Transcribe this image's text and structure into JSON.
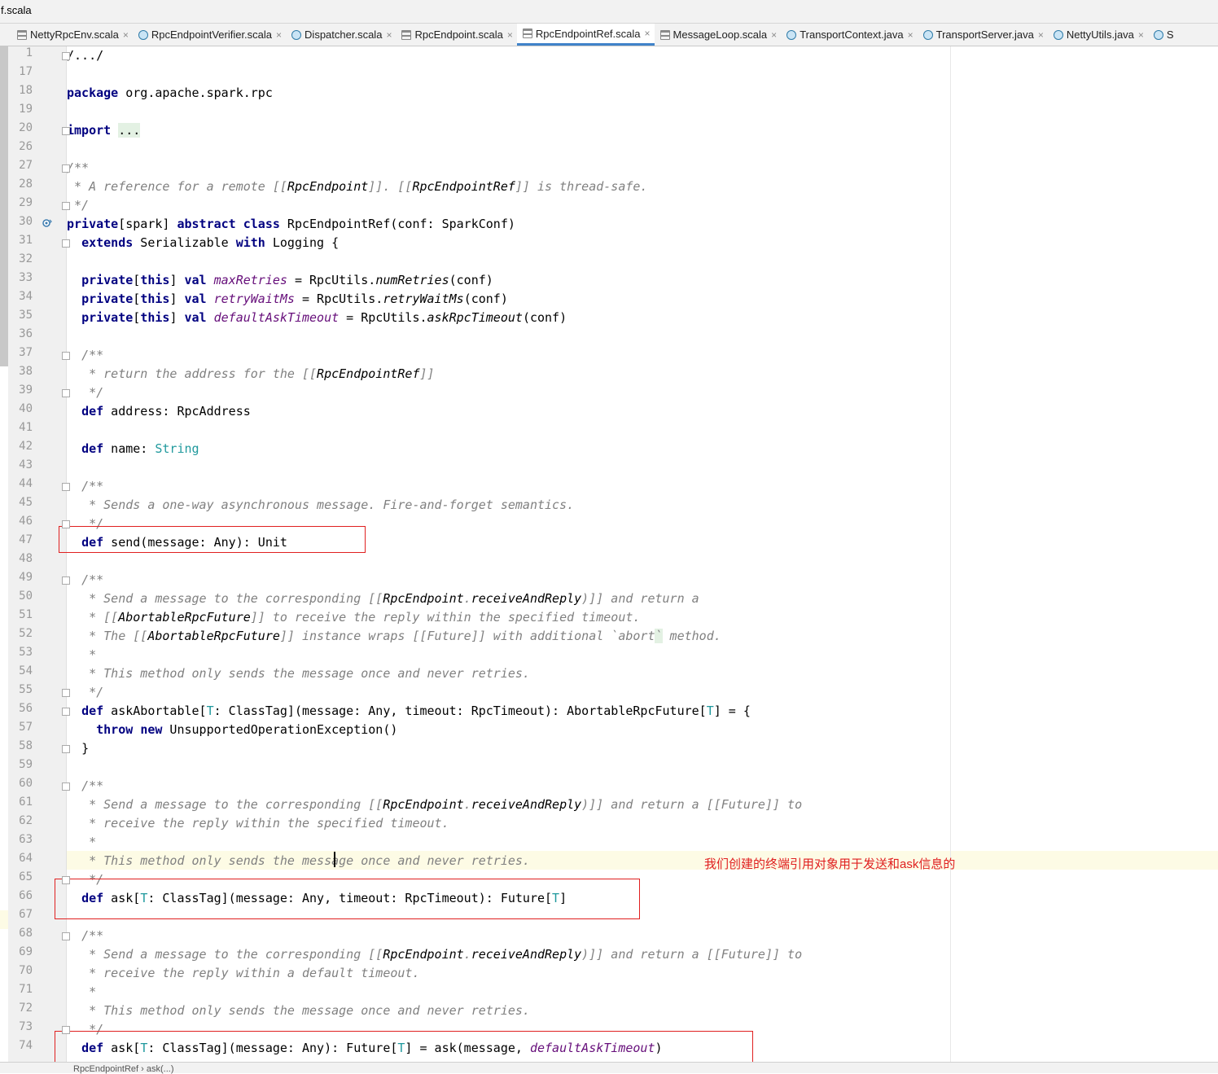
{
  "window": {
    "title": "f.scala"
  },
  "tabs": [
    {
      "label": "NettyRpcEnv.scala",
      "icon": "scala-file-icon",
      "active": false
    },
    {
      "label": "RpcEndpointVerifier.scala",
      "icon": "class-icon",
      "active": false
    },
    {
      "label": "Dispatcher.scala",
      "icon": "class-icon",
      "active": false
    },
    {
      "label": "RpcEndpoint.scala",
      "icon": "scala-file-icon",
      "active": false
    },
    {
      "label": "RpcEndpointRef.scala",
      "icon": "scala-file-icon",
      "active": true
    },
    {
      "label": "MessageLoop.scala",
      "icon": "scala-file-icon",
      "active": false
    },
    {
      "label": "TransportContext.java",
      "icon": "class-icon",
      "active": false
    },
    {
      "label": "TransportServer.java",
      "icon": "class-icon",
      "active": false
    },
    {
      "label": "NettyUtils.java",
      "icon": "class-icon",
      "active": false
    },
    {
      "label": "S",
      "icon": "class-icon",
      "active": false
    }
  ],
  "editor": {
    "line_numbers": [
      "1",
      "17",
      "18",
      "19",
      "20",
      "26",
      "27",
      "28",
      "29",
      "30",
      "31",
      "32",
      "33",
      "34",
      "35",
      "36",
      "37",
      "38",
      "39",
      "40",
      "41",
      "42",
      "43",
      "44",
      "45",
      "46",
      "47",
      "48",
      "49",
      "50",
      "51",
      "52",
      "53",
      "54",
      "55",
      "56",
      "57",
      "58",
      "59",
      "60",
      "61",
      "62",
      "63",
      "64",
      "65",
      "66",
      "67",
      "68",
      "69",
      "70",
      "71",
      "72",
      "73",
      "74"
    ],
    "code": {
      "l1": "/.../",
      "l18_kw": "package",
      "l18_rest": " org.apache.spark.rpc",
      "l20_kw": "import",
      "l20_dots": "...",
      "l27": "/**",
      "l28_a": " * A reference for a remote [[",
      "l28_b": "RpcEndpoint",
      "l28_c": "]]. [[",
      "l28_d": "RpcEndpointRef",
      "l28_e": "]] is thread-safe.",
      "l29": " */",
      "l30_kw1": "private",
      "l30_a": "[spark] ",
      "l30_kw2": "abstract class",
      "l30_b": " RpcEndpointRef(conf: SparkConf)",
      "l31_kw1": "extends",
      "l31_a": " Serializable ",
      "l31_kw2": "with",
      "l31_b": " Logging {",
      "l33_kw1": "private",
      "l33_a": "[",
      "l33_kw2": "this",
      "l33_b": "] ",
      "l33_kw3": "val",
      "l33_f": "maxRetries",
      "l33_c": " = RpcUtils.",
      "l33_m": "numRetries",
      "l33_d": "(conf)",
      "l34_f": "retryWaitMs",
      "l34_c": " = RpcUtils.",
      "l34_m": "retryWaitMs",
      "l34_d": "(conf)",
      "l35_f": "defaultAskTimeout",
      "l35_c": " = RpcUtils.",
      "l35_m": "askRpcTimeout",
      "l35_d": "(conf)",
      "l37": "/**",
      "l38_a": " * return the address for the [[",
      "l38_b": "RpcEndpointRef",
      "l38_c": "]]",
      "l39": " */",
      "l40_kw": "def",
      "l40_rest": " address: RpcAddress",
      "l42_kw": "def",
      "l42_a": " name: ",
      "l42_ty": "String",
      "l44": "/**",
      "l45": " * Sends a one-way asynchronous message. Fire-and-forget semantics.",
      "l46": " */",
      "l47_kw": "def",
      "l47_rest": " send(message: Any): Unit",
      "l49": "/**",
      "l50_a": " * Send a message to the corresponding [[",
      "l50_b": "RpcEndpoint",
      "l50_c": ".",
      "l50_d": "receiveAndReply",
      "l50_e": ")]] and return a",
      "l51_a": " * [[",
      "l51_b": "AbortableRpcFuture",
      "l51_c": "]] to receive the reply within the specified timeout.",
      "l52_a": " * The [[",
      "l52_b": "AbortableRpcFuture",
      "l52_c": "]] instance wraps [[Future]] with additional `abort",
      "l52_d": "`",
      "l52_e": " method.",
      "l53": " *",
      "l54": " * This method only sends the message once and never retries.",
      "l55": " */",
      "l56_kw": "def",
      "l56_a": " askAbortable[",
      "l56_t": "T",
      "l56_b": ": ClassTag](message: Any, timeout: RpcTimeout): AbortableRpcFuture[",
      "l56_t2": "T",
      "l56_c": "] = {",
      "l57_kw1": "throw",
      "l57_kw2": "new",
      "l57_rest": " UnsupportedOperationException()",
      "l58": "}",
      "l60": "/**",
      "l61_a": " * Send a message to the corresponding [[",
      "l61_b": "RpcEndpoint",
      "l61_c": ".",
      "l61_d": "receiveAndReply",
      "l61_e": ")]] and return a [[Future]] to",
      "l62": " * receive the reply within the specified timeout.",
      "l63": " *",
      "l64": " * This method only sends the message once and never retries.",
      "l65": " */",
      "l66_kw": "def",
      "l66_a": " ask[",
      "l66_t": "T",
      "l66_b": ": ClassTag](message: Any, timeout: RpcTimeout): Future[",
      "l66_t2": "T",
      "l66_c": "]",
      "l68": "/**",
      "l69_a": " * Send a message to the corresponding [[",
      "l69_b": "RpcEndpoint",
      "l69_c": ".",
      "l69_d": "receiveAndReply",
      "l69_e": ")]] and return a [[Future]] to",
      "l70": " * receive the reply within a default timeout.",
      "l71": " *",
      "l72": " * This method only sends the message once and never retries.",
      "l73": " */",
      "l74_kw": "def",
      "l74_a": " ask[",
      "l74_t": "T",
      "l74_b": ": ClassTag](message: Any): Future[",
      "l74_t2": "T",
      "l74_c": "] = ask(message, ",
      "l74_f": "defaultAskTimeout",
      "l74_d": ")"
    }
  },
  "annotation": {
    "text": "我们创建的终端引用对象用于发送和ask信息的",
    "color": "#e02020"
  },
  "statusbar": {
    "breadcrumb": "RpcEndpointRef  ›  ask(...)"
  }
}
